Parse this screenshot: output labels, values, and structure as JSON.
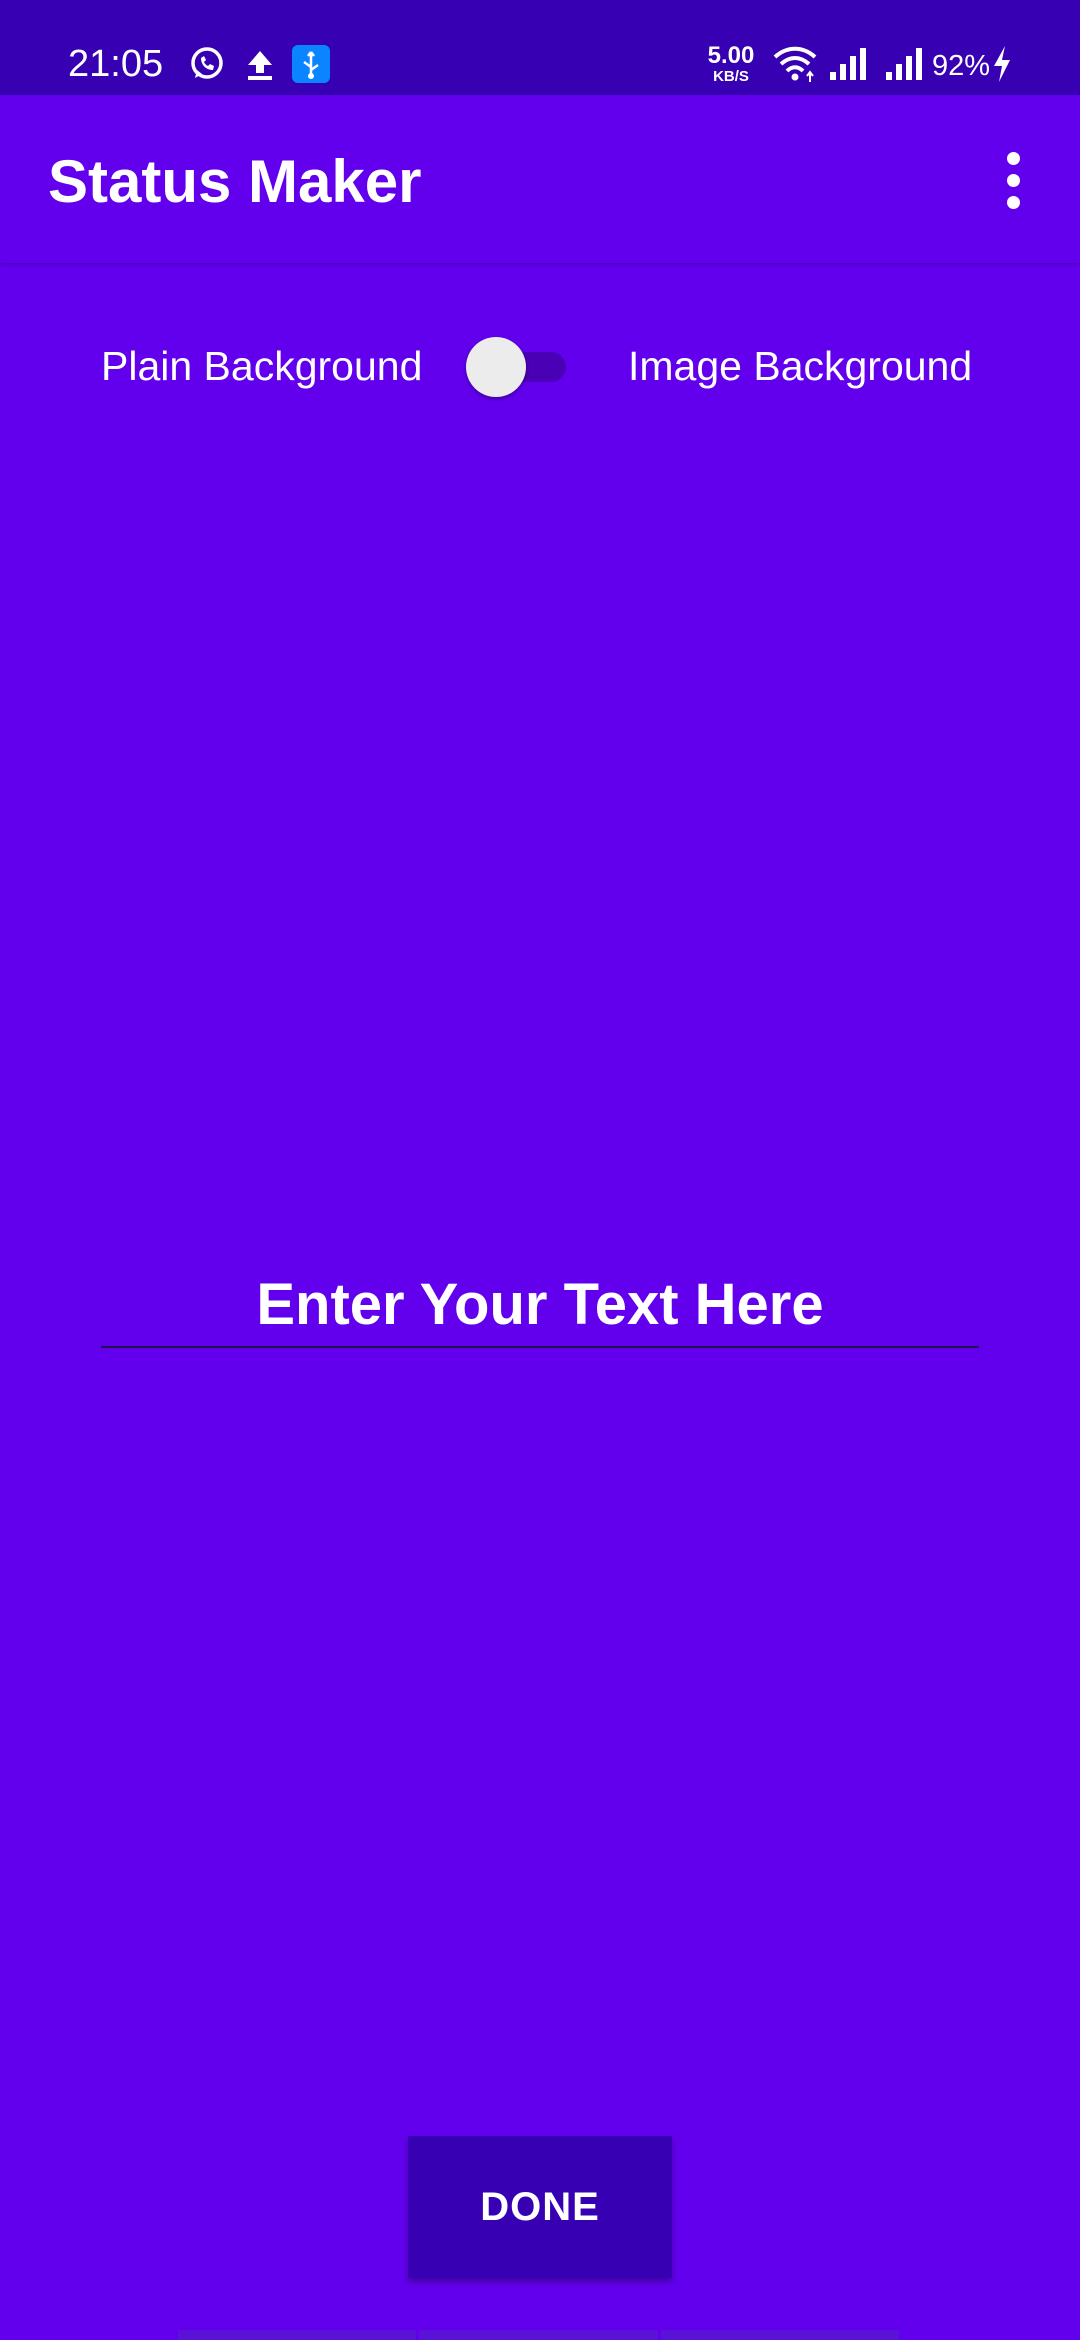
{
  "status_bar": {
    "time": "21:05",
    "net_speed_value": "5.00",
    "net_speed_unit": "KB/S",
    "battery": "92%",
    "icons": [
      "whatsapp-icon",
      "upload-icon",
      "usb-icon",
      "wifi-icon",
      "signal-icon",
      "signal-icon",
      "charging-icon"
    ]
  },
  "app_bar": {
    "title": "Status Maker",
    "overflow_icon": "more-vert-icon"
  },
  "background_toggle": {
    "left_label": "Plain Background",
    "right_label": "Image Background",
    "checked": false
  },
  "editor": {
    "placeholder": "Enter Your Text Here",
    "value": ""
  },
  "actions": {
    "done_label": "DONE"
  },
  "colors": {
    "primary": "#6200EE",
    "primary_dark": "#3700B3",
    "text": "#FFFFFF"
  }
}
